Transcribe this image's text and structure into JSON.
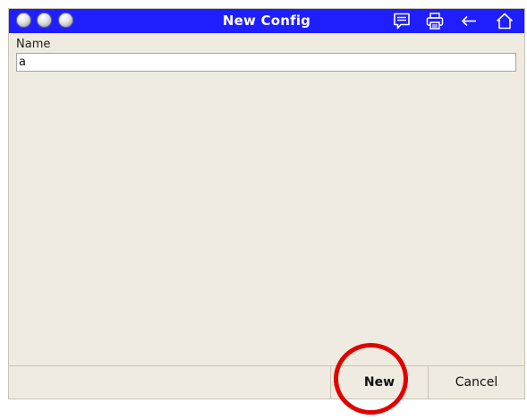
{
  "window": {
    "title": "New Config",
    "title_bar_color": "#1e1eff",
    "traffic_lights": [
      "window-dot",
      "window-dot",
      "window-dot"
    ]
  },
  "toolbar": {
    "icons": [
      "comment-icon",
      "print-icon",
      "back-arrow-icon",
      "home-icon"
    ]
  },
  "form": {
    "name_label": "Name",
    "name_value": "a"
  },
  "footer": {
    "new_label": "New",
    "cancel_label": "Cancel"
  },
  "annotation": {
    "highlight_color": "#e00000",
    "highlighted_element": "new-button"
  }
}
